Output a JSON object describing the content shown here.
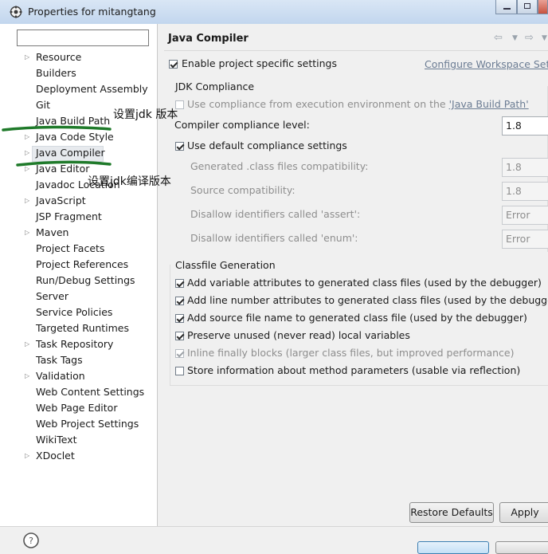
{
  "window": {
    "title": "Properties for mitangtang"
  },
  "tree": {
    "filter_placeholder": "",
    "items": [
      {
        "label": "Resource",
        "expandable": true
      },
      {
        "label": "Builders",
        "expandable": false
      },
      {
        "label": "Deployment Assembly",
        "expandable": false
      },
      {
        "label": "Git",
        "expandable": false
      },
      {
        "label": "Java Build Path",
        "expandable": false
      },
      {
        "label": "Java Code Style",
        "expandable": true
      },
      {
        "label": "Java Compiler",
        "expandable": true,
        "selected": true
      },
      {
        "label": "Java Editor",
        "expandable": true
      },
      {
        "label": "Javadoc Location",
        "expandable": false
      },
      {
        "label": "JavaScript",
        "expandable": true
      },
      {
        "label": "JSP Fragment",
        "expandable": false
      },
      {
        "label": "Maven",
        "expandable": true
      },
      {
        "label": "Project Facets",
        "expandable": false
      },
      {
        "label": "Project References",
        "expandable": false
      },
      {
        "label": "Run/Debug Settings",
        "expandable": false
      },
      {
        "label": "Server",
        "expandable": false
      },
      {
        "label": "Service Policies",
        "expandable": false
      },
      {
        "label": "Targeted Runtimes",
        "expandable": false
      },
      {
        "label": "Task Repository",
        "expandable": true
      },
      {
        "label": "Task Tags",
        "expandable": false
      },
      {
        "label": "Validation",
        "expandable": true
      },
      {
        "label": "Web Content Settings",
        "expandable": false
      },
      {
        "label": "Web Page Editor",
        "expandable": false
      },
      {
        "label": "Web Project Settings",
        "expandable": false
      },
      {
        "label": "WikiText",
        "expandable": false
      },
      {
        "label": "XDoclet",
        "expandable": true
      }
    ]
  },
  "page": {
    "title": "Java Compiler",
    "enable_project_specific": {
      "label": "Enable project specific settings",
      "checked": true
    },
    "configure_link": "Configure Workspace Setti",
    "jdk": {
      "group_title": "JDK Compliance",
      "use_env": {
        "label": "Use compliance from execution environment on the ",
        "link": "'Java Build Path'",
        "checked": false
      },
      "compliance_level": {
        "label": "Compiler compliance level:",
        "value": "1.8"
      },
      "use_default": {
        "label": "Use default compliance settings",
        "checked": true
      },
      "generated": {
        "label": "Generated .class files compatibility:",
        "value": "1.8"
      },
      "source": {
        "label": "Source compatibility:",
        "value": "1.8"
      },
      "assert": {
        "label": "Disallow identifiers called 'assert':",
        "value": "Error"
      },
      "enum": {
        "label": "Disallow identifiers called 'enum':",
        "value": "Error"
      }
    },
    "classfile": {
      "group_title": "Classfile Generation",
      "options": [
        {
          "label": "Add variable attributes to generated class files (used by the debugger)",
          "checked": true,
          "disabled": false
        },
        {
          "label": "Add line number attributes to generated class files (used by the debugger)",
          "checked": true,
          "disabled": false
        },
        {
          "label": "Add source file name to generated class file (used by the debugger)",
          "checked": true,
          "disabled": false
        },
        {
          "label": "Preserve unused (never read) local variables",
          "checked": true,
          "disabled": false
        },
        {
          "label": "Inline finally blocks (larger class files, but improved performance)",
          "checked": true,
          "disabled": true
        },
        {
          "label": "Store information about method parameters (usable via reflection)",
          "checked": false,
          "disabled": false
        }
      ]
    },
    "buttons": {
      "restore_defaults": "Restore Defaults",
      "apply": "Apply"
    }
  },
  "annotations": {
    "build_path_note": "设置jdk 版本",
    "compiler_note": "设置jdk编译版本",
    "marker_color": "#1f7a2a"
  },
  "icons": [
    "eclipse-gear-icon",
    "back-arrow-icon",
    "forward-arrow-icon",
    "dropdown-icon",
    "help-icon"
  ]
}
